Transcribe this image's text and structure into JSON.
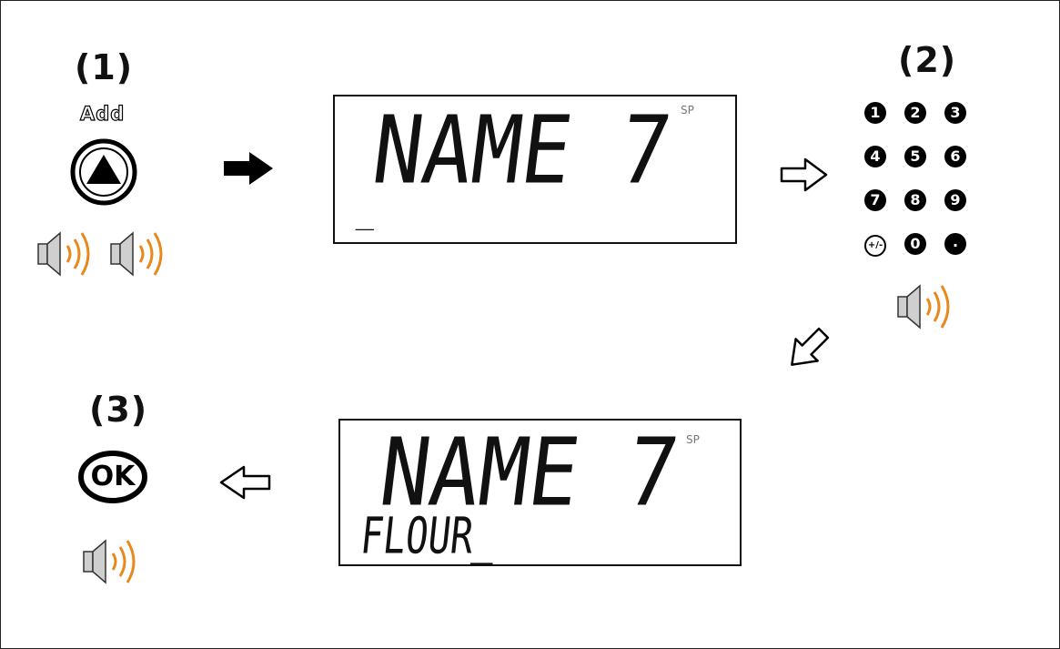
{
  "steps": {
    "step1": "(1)",
    "step2": "(2)",
    "step3": "(3)"
  },
  "add_button": {
    "label": "Add",
    "icon": "up-triangle-icon"
  },
  "ok_button": {
    "label": "OK"
  },
  "display_top": {
    "main": "NAME 7",
    "sub": "_",
    "indicator": "SP"
  },
  "display_bottom": {
    "main": "NAME 7",
    "sub": "FLOUR_",
    "indicator": "SP"
  },
  "keypad": {
    "keys": [
      "1",
      "2",
      "3",
      "4",
      "5",
      "6",
      "7",
      "8",
      "9",
      "+/-",
      "0",
      "."
    ]
  },
  "colors": {
    "sound_waves": "#e8891c",
    "speaker_body": "#cfcfcf"
  }
}
